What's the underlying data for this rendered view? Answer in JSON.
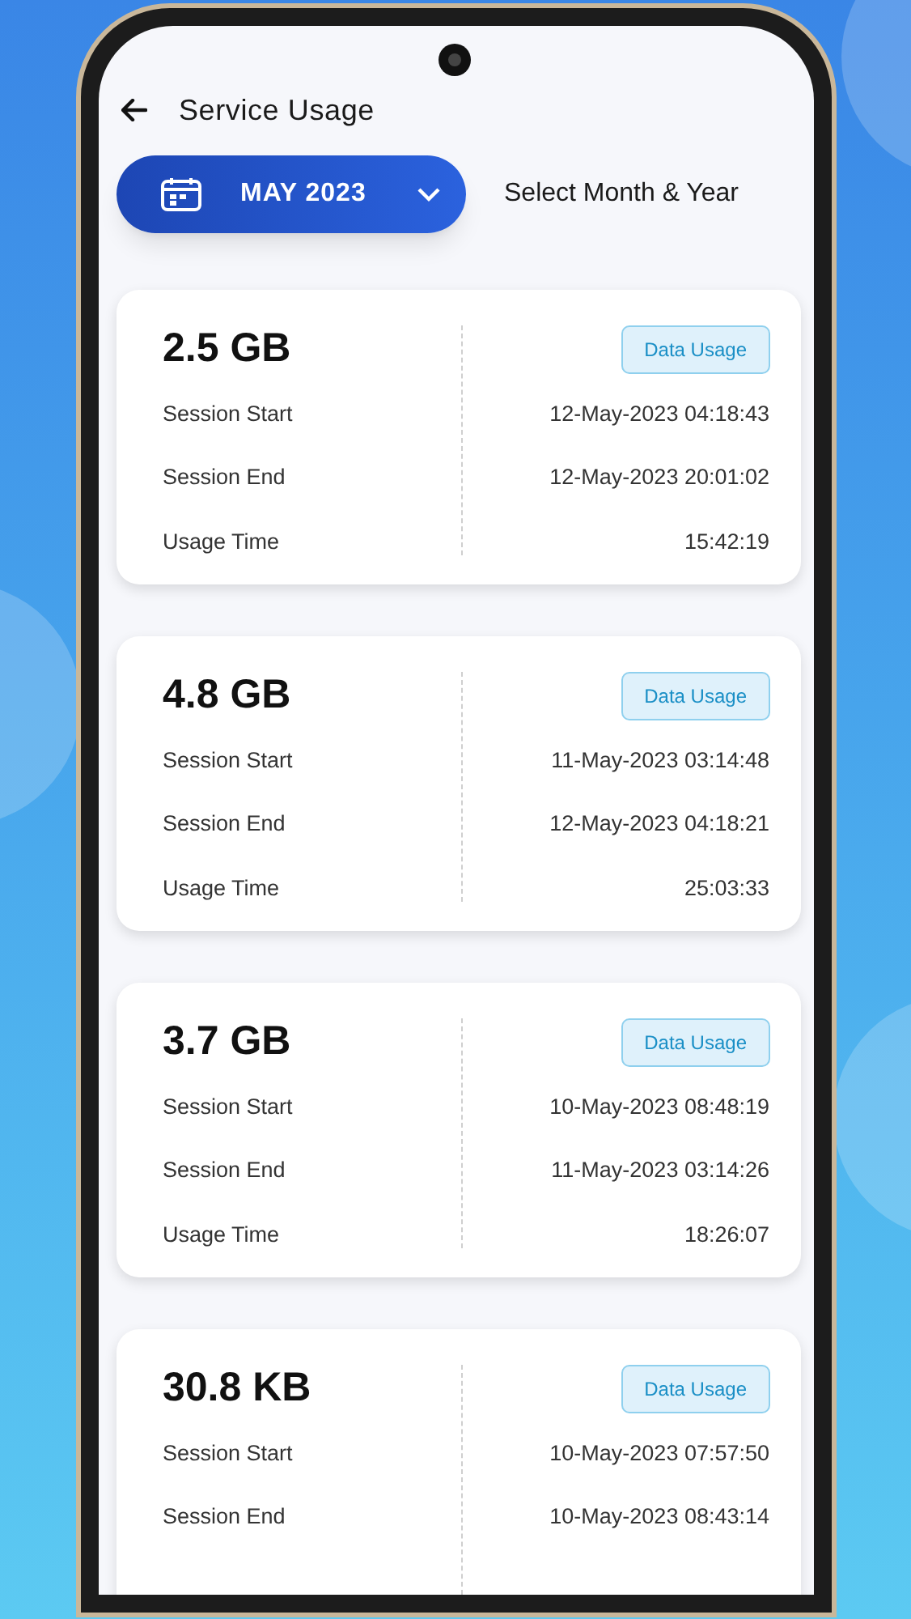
{
  "header": {
    "title": "Service Usage"
  },
  "month_picker": {
    "value": "MAY 2023",
    "hint": "Select Month & Year"
  },
  "cards": [
    {
      "amount": "2.5 GB",
      "badge": "Data Usage",
      "rows": [
        {
          "label": "Session Start",
          "value": "12-May-2023 04:18:43"
        },
        {
          "label": "Session End",
          "value": "12-May-2023 20:01:02"
        },
        {
          "label": "Usage Time",
          "value": "15:42:19"
        }
      ]
    },
    {
      "amount": "4.8 GB",
      "badge": "Data Usage",
      "rows": [
        {
          "label": "Session Start",
          "value": "11-May-2023 03:14:48"
        },
        {
          "label": "Session End",
          "value": "12-May-2023 04:18:21"
        },
        {
          "label": "Usage Time",
          "value": "25:03:33"
        }
      ]
    },
    {
      "amount": "3.7 GB",
      "badge": "Data Usage",
      "rows": [
        {
          "label": "Session Start",
          "value": "10-May-2023 08:48:19"
        },
        {
          "label": "Session End",
          "value": "11-May-2023 03:14:26"
        },
        {
          "label": "Usage Time",
          "value": "18:26:07"
        }
      ]
    },
    {
      "amount": "30.8 KB",
      "badge": "Data Usage",
      "rows": [
        {
          "label": "Session Start",
          "value": "10-May-2023 07:57:50"
        },
        {
          "label": "Session End",
          "value": "10-May-2023 08:43:14"
        }
      ]
    }
  ]
}
